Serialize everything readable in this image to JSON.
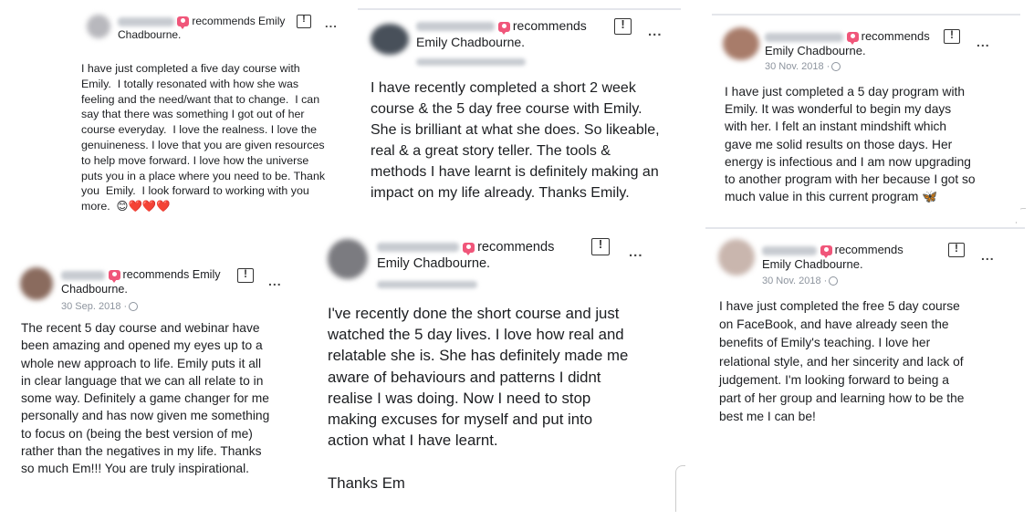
{
  "reviews": [
    {
      "recommends": "recommends Emily",
      "recommends2": "Chadbourne.",
      "date": "",
      "text": "I have just completed a five day course with\nEmily.  I totally resonated with how she was\nfeeling and the need/want that to change.  I can\nsay that there was something I got out of her\ncourse everyday.  I love the realness. I love the\ngenuineness. I love that you are given resources\nto help move forward. I love how the universe\nputs you in a place where you need to be. Thank\nyou  Emily.  I look forward to working with you\nmore.  😊❤️❤️❤️"
    },
    {
      "recommends": "recommends",
      "recommends2": "Emily Chadbourne.",
      "date": "",
      "text": "I have recently completed a short 2 week\ncourse & the 5 day free course with Emily.\nShe is brilliant at what she does. So likeable,\nreal & a great story teller. The tools &\nmethods I have learnt is definitely making an\nimpact on my life already. Thanks Emily."
    },
    {
      "recommends": "recommends",
      "recommends2": "Emily Chadbourne.",
      "date": "30 Nov. 2018 ·",
      "text": "I have just completed a 5 day program with\nEmily. It was wonderful to begin my days\nwith her. I felt an instant mindshift which\ngave me solid results on those days. Her\nenergy is infectious and I am now upgrading\nto another program with her because I got so\nmuch value in this current program 🦋"
    },
    {
      "recommends": "recommends Emily",
      "recommends2": "Chadbourne.",
      "date": "30 Sep. 2018 ·",
      "text": "The recent 5 day course and webinar have\nbeen amazing and opened my eyes up to a\nwhole new approach to life. Emily puts it all\nin clear language that we can all relate to in\nsome way. Definitely a game changer for me\npersonally and has now given me something\nto focus on (being the best version of me)\nrather than the negatives in my life. Thanks\nso much Em!!! You are truly inspirational."
    },
    {
      "recommends": "recommends",
      "recommends2": "Emily Chadbourne.",
      "date": "",
      "text": "I've recently done the short course and just\nwatched the 5 day lives. I love how real and\nrelatable she is. She has definitely made me\naware of behaviours and patterns I didnt\nrealise I was doing. Now I need to stop\nmaking excuses for myself and put into\naction what I have learnt.\n\nThanks Em"
    },
    {
      "recommends": "recommends",
      "recommends2": "Emily Chadbourne.",
      "date": "30 Nov. 2018 ·",
      "text": "I have just completed the free 5 day course\non FaceBook, and have already seen the\nbenefits of Emily's teaching. I love her\nrelational style, and her sincerity and lack of\njudgement. I'm looking forward to being a\npart of her group and learning how to be the\nbest me I can be!"
    }
  ],
  "more_label": "...",
  "icons": {
    "flag": "report-flag-icon",
    "globe": "globe-icon",
    "recommend": "recommend-icon"
  }
}
